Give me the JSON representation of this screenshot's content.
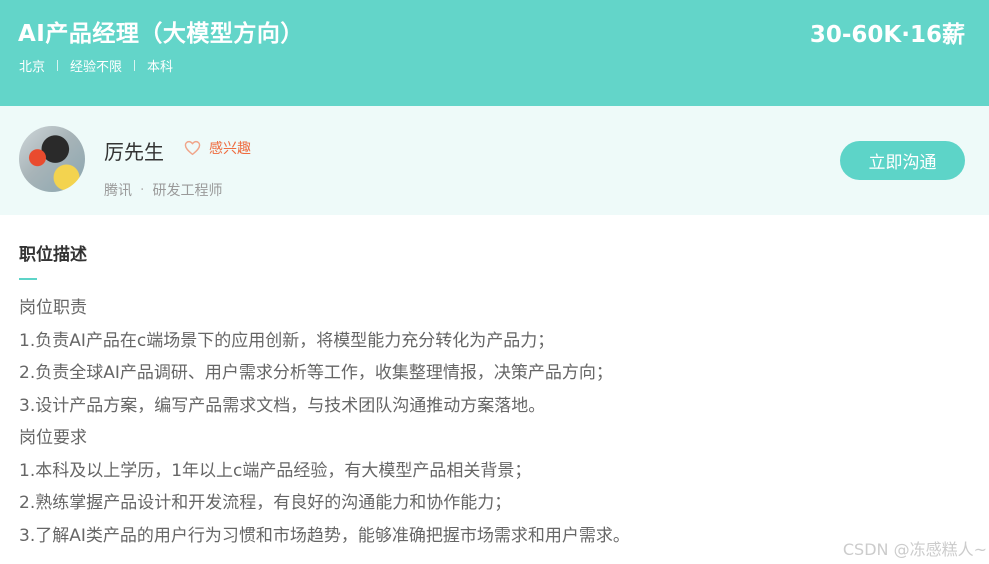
{
  "header": {
    "title": "AI产品经理（大模型方向）",
    "salary": "30-60K·16薪",
    "tags": [
      "北京",
      "经验不限",
      "本科"
    ]
  },
  "boss": {
    "name": "厉先生",
    "interest_label": "感兴趣",
    "company": "腾讯",
    "position": "研发工程师",
    "chat_button": "立即沟通"
  },
  "description": {
    "section_title": "职位描述",
    "lines": [
      "岗位职责",
      "1.负责AI产品在c端场景下的应用创新，将模型能力充分转化为产品力；",
      "2.负责全球AI产品调研、用户需求分析等工作，收集整理情报，决策产品方向；",
      "3.设计产品方案，编写产品需求文档，与技术团队沟通推动方案落地。",
      "岗位要求",
      "1.本科及以上学历，1年以上c端产品经验，有大模型产品相关背景；",
      "2.熟练掌握产品设计和开发流程，有良好的沟通能力和协作能力；",
      "3.了解AI类产品的用户行为习惯和市场趋势，能够准确把握市场需求和用户需求。"
    ]
  },
  "watermark": "CSDN @冻感糕人~",
  "colors": {
    "header_bg": "#63d5c9",
    "boss_bar_bg": "#eefaf9",
    "accent": "#5dd4c8",
    "interest": "#ef6c3f"
  },
  "icons": {
    "interest": "heart-outline-icon"
  }
}
